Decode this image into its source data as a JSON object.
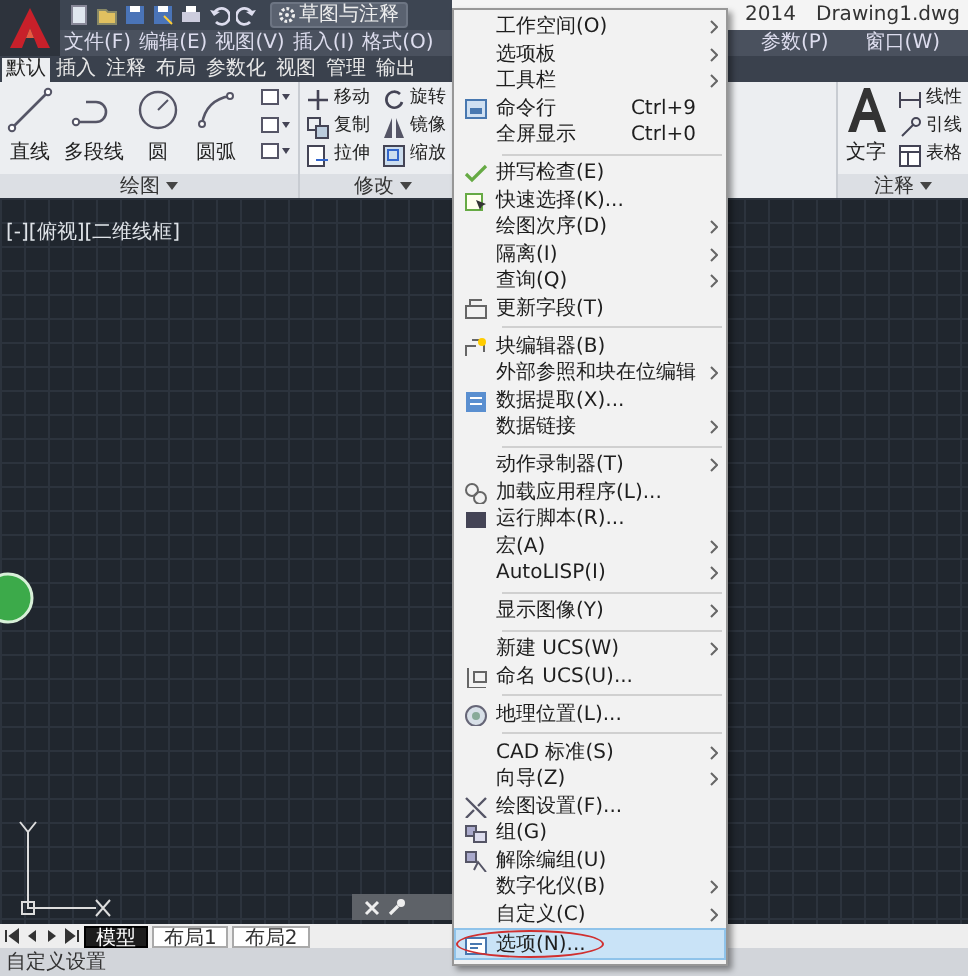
{
  "title_bar": {
    "workspace": "草图与注释",
    "title_parts": [
      "2014",
      "Drawing1.dwg"
    ]
  },
  "menu_bar": {
    "left": [
      {
        "label": "文件(F)"
      },
      {
        "label": "编辑(E)"
      },
      {
        "label": "视图(V)"
      },
      {
        "label": "插入(I)"
      },
      {
        "label": "格式(O)"
      }
    ],
    "right": [
      {
        "label": "参数(P)"
      },
      {
        "label": "窗口(W)"
      }
    ]
  },
  "ribbon_tabs": [
    {
      "label": "默认",
      "selected": true
    },
    {
      "label": "插入",
      "selected": false
    },
    {
      "label": "注释",
      "selected": false
    },
    {
      "label": "布局",
      "selected": false
    },
    {
      "label": "参数化",
      "selected": false
    },
    {
      "label": "视图",
      "selected": false
    },
    {
      "label": "管理",
      "selected": false
    },
    {
      "label": "输出",
      "selected": false
    }
  ],
  "ribbon_panels": [
    {
      "kind": "draw",
      "title": "绘图",
      "tools": [
        {
          "label": "直线"
        },
        {
          "label": "多段线"
        },
        {
          "label": "圆"
        },
        {
          "label": "圆弧"
        }
      ]
    },
    {
      "kind": "modify",
      "title": "修改",
      "tools": [
        {
          "label": "移动"
        },
        {
          "label": "旋转"
        },
        {
          "label": "复制"
        },
        {
          "label": "镜像"
        },
        {
          "label": "拉伸"
        },
        {
          "label": "缩放"
        }
      ]
    },
    {
      "kind": "annotation",
      "title": "注释",
      "tools": [
        {
          "label": "文字"
        },
        {
          "label": "线性"
        },
        {
          "label": "引线"
        },
        {
          "label": "表格"
        }
      ]
    }
  ],
  "viewport": {
    "label": "[-][俯视][二维线框]"
  },
  "layout_tabs": [
    {
      "label": "模型",
      "selected": true
    },
    {
      "label": "布局1",
      "selected": false
    },
    {
      "label": "布局2",
      "selected": false
    }
  ],
  "command_line": {
    "text": "自定义设置"
  },
  "tools_menu": {
    "items": [
      {
        "kind": "item",
        "label": "工作空间(O)",
        "submenu": true,
        "has_icon": false,
        "selected": false
      },
      {
        "kind": "item",
        "label": "选项板",
        "submenu": true,
        "has_icon": false,
        "selected": false
      },
      {
        "kind": "item",
        "label": "工具栏",
        "submenu": true,
        "has_icon": false,
        "selected": false
      },
      {
        "kind": "item",
        "label": "命令行",
        "shortcut": "Ctrl+9",
        "submenu": false,
        "has_icon": true,
        "selected": false
      },
      {
        "kind": "item",
        "label": "全屏显示",
        "shortcut": "Ctrl+0",
        "submenu": false,
        "has_icon": false,
        "selected": false
      },
      {
        "kind": "separator"
      },
      {
        "kind": "item",
        "label": "拼写检查(E)",
        "submenu": false,
        "has_icon": true,
        "selected": false
      },
      {
        "kind": "item",
        "label": "快速选择(K)...",
        "submenu": false,
        "has_icon": true,
        "selected": false
      },
      {
        "kind": "item",
        "label": "绘图次序(D)",
        "submenu": true,
        "has_icon": false,
        "selected": false
      },
      {
        "kind": "item",
        "label": "隔离(I)",
        "submenu": true,
        "has_icon": false,
        "selected": false
      },
      {
        "kind": "item",
        "label": "查询(Q)",
        "submenu": true,
        "has_icon": false,
        "selected": false
      },
      {
        "kind": "item",
        "label": "更新字段(T)",
        "submenu": false,
        "has_icon": true,
        "selected": false
      },
      {
        "kind": "separator"
      },
      {
        "kind": "item",
        "label": "块编辑器(B)",
        "submenu": false,
        "has_icon": true,
        "selected": false
      },
      {
        "kind": "item",
        "label": "外部参照和块在位编辑",
        "submenu": true,
        "has_icon": false,
        "selected": false
      },
      {
        "kind": "item",
        "label": "数据提取(X)...",
        "submenu": false,
        "has_icon": true,
        "selected": false
      },
      {
        "kind": "item",
        "label": "数据链接",
        "submenu": true,
        "has_icon": false,
        "selected": false
      },
      {
        "kind": "separator"
      },
      {
        "kind": "item",
        "label": "动作录制器(T)",
        "submenu": true,
        "has_icon": false,
        "selected": false
      },
      {
        "kind": "item",
        "label": "加载应用程序(L)...",
        "submenu": false,
        "has_icon": true,
        "selected": false
      },
      {
        "kind": "item",
        "label": "运行脚本(R)...",
        "submenu": false,
        "has_icon": true,
        "selected": false
      },
      {
        "kind": "item",
        "label": "宏(A)",
        "submenu": true,
        "has_icon": false,
        "selected": false
      },
      {
        "kind": "item",
        "label": "AutoLISP(I)",
        "submenu": true,
        "has_icon": false,
        "selected": false
      },
      {
        "kind": "separator"
      },
      {
        "kind": "item",
        "label": "显示图像(Y)",
        "submenu": true,
        "has_icon": false,
        "selected": false
      },
      {
        "kind": "separator"
      },
      {
        "kind": "item",
        "label": "新建 UCS(W)",
        "submenu": true,
        "has_icon": false,
        "selected": false
      },
      {
        "kind": "item",
        "label": "命名 UCS(U)...",
        "submenu": false,
        "has_icon": true,
        "selected": false
      },
      {
        "kind": "separator"
      },
      {
        "kind": "item",
        "label": "地理位置(L)...",
        "submenu": false,
        "has_icon": true,
        "selected": false
      },
      {
        "kind": "separator"
      },
      {
        "kind": "item",
        "label": "CAD 标准(S)",
        "submenu": true,
        "has_icon": false,
        "selected": false
      },
      {
        "kind": "item",
        "label": "向导(Z)",
        "submenu": true,
        "has_icon": false,
        "selected": false
      },
      {
        "kind": "item",
        "label": "绘图设置(F)...",
        "submenu": false,
        "has_icon": true,
        "selected": false
      },
      {
        "kind": "item",
        "label": "组(G)",
        "submenu": false,
        "has_icon": true,
        "selected": false
      },
      {
        "kind": "item",
        "label": "解除编组(U)",
        "submenu": false,
        "has_icon": true,
        "selected": false
      },
      {
        "kind": "item",
        "label": "数字化仪(B)",
        "submenu": true,
        "has_icon": false,
        "selected": false
      },
      {
        "kind": "item",
        "label": "自定义(C)",
        "submenu": true,
        "has_icon": false,
        "selected": false
      },
      {
        "kind": "item",
        "label": "选项(N)...",
        "submenu": false,
        "has_icon": true,
        "selected": true,
        "circled": true
      }
    ]
  }
}
